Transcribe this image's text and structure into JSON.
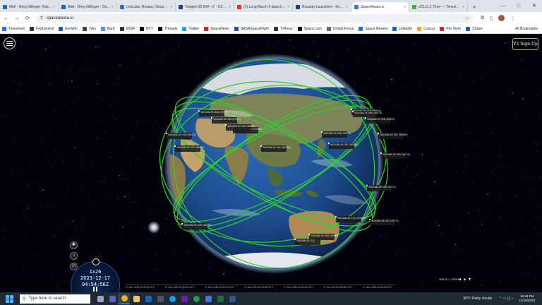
{
  "browser": {
    "tabs": [
      {
        "label": "Mail - Greg Gillinger (Inte...",
        "color": "#0f6cbd",
        "active": false
      },
      {
        "label": "Mail - Greg Gillinger - Ou...",
        "color": "#0f6cbd",
        "active": false
      },
      {
        "label": "LeoLabs: Russia, China ma...",
        "color": "#2b6fd6",
        "active": false
      },
      {
        "label": "Yaogan-39 05A - C - CZ-2...",
        "color": "#1e3c8c",
        "active": false
      },
      {
        "label": "(3) Long March-5 launch...",
        "color": "#e52d27",
        "active": false
      },
      {
        "label": "Russian Launchers - Soyu...",
        "color": "#1e3c8c",
        "active": false
      },
      {
        "label": "SpaceAware.io",
        "color": "#3a7bd5",
        "active": true
      },
      {
        "label": "v23.11.1 Time --- Timeslo...",
        "color": "#3cb043",
        "active": false
      }
    ],
    "new_tab": "+",
    "window_controls": [
      "—",
      "□",
      "✕"
    ],
    "url": "spaceaware.io",
    "bookmarks": [
      {
        "label": "Timesheet",
        "color": "#2b6fd6"
      },
      {
        "label": "FedCentral",
        "color": "#333"
      },
      {
        "label": "GovWin",
        "color": "#1e5aa8"
      },
      {
        "label": "Tyks",
        "color": "#444"
      },
      {
        "label": "Bard",
        "color": "#4a8ef0"
      },
      {
        "label": "I2ISR",
        "color": "#333"
      },
      {
        "label": "NYT",
        "color": "#111"
      },
      {
        "label": "Threads",
        "color": "#111"
      },
      {
        "label": "Twitter",
        "color": "#1da1f2"
      },
      {
        "label": "SpaceNews",
        "color": "#e31b23"
      },
      {
        "label": "NASASpaceFlight",
        "color": "#2b4f9e"
      },
      {
        "label": "T-Minus",
        "color": "#333"
      },
      {
        "label": "Space.com",
        "color": "#111"
      },
      {
        "label": "Orbital Focus",
        "color": "#666"
      },
      {
        "label": "Space Review",
        "color": "#2b6fd6"
      },
      {
        "label": "LinkedIn",
        "color": "#0a66c2"
      },
      {
        "label": "Concur",
        "color": "#f0a030"
      },
      {
        "label": "Per Diem",
        "color": "#c62828"
      },
      {
        "label": "Chase",
        "color": "#1a5fb4"
      }
    ],
    "all_bookmarks": "All Bookmarks"
  },
  "app": {
    "signup_label": "V2 Sign-Up",
    "time_scale": "1x26",
    "date": "2023-12-17",
    "time": "04:54:56Z",
    "speed_label": "SPACE: 1 WEEK",
    "timeline_labels": [
      "17 Dec 2023 04:54:00 UTC",
      "17 Dec 2023 04:54:10 UTC",
      "17 Dec 2023 04:54:20 UTC",
      "17 Dec 2023 04:54:30 UTC",
      "17 Dec 2023 04:54:40 UTC",
      "17 Dec 2023 04:54:50 UTC",
      "17 Dec 2023 04:55:00 UTC"
    ],
    "satellites": [
      "YAOGAN-39 02A (57980)",
      "YAOGAN-39 02B (57981)",
      "YAOGAN-39 02C (57982)",
      "YAOGAN-39 03A (58030)",
      "YAOGAN-39 03B (58031)",
      "YAOGAN-39 03C (58032)",
      "YAOGAN-39 04A (58378)",
      "YAOGAN-39 04B (58379)",
      "YAOGAN-39 04C (58380)",
      "YAOGAN-39 05A (58594)",
      "YAOGAN-39 05B (58595)",
      "YAOGAN-39 05C (58596)",
      "YAOGAN-36 05A (54170)",
      "YAOGAN-36 05B (54171)",
      "YAOGAN-36 05C (54172)",
      "YAOGAN-39 01A (55984)",
      "YAOGAN-39 01B (55985)",
      "YAOGAN-39 01C",
      "YAOGAN-39 05B (58595)",
      "YAOGAN-36 06A (56178)"
    ]
  },
  "taskbar": {
    "search_placeholder": "Type here to search",
    "weather": "56°F  Partly cloudy",
    "time": "10:46 PM",
    "date": "12/16/2023"
  },
  "colors": {
    "orbit": "#2fd12f",
    "ocean": "#1d4d8f",
    "land": "#6b7a4e"
  }
}
